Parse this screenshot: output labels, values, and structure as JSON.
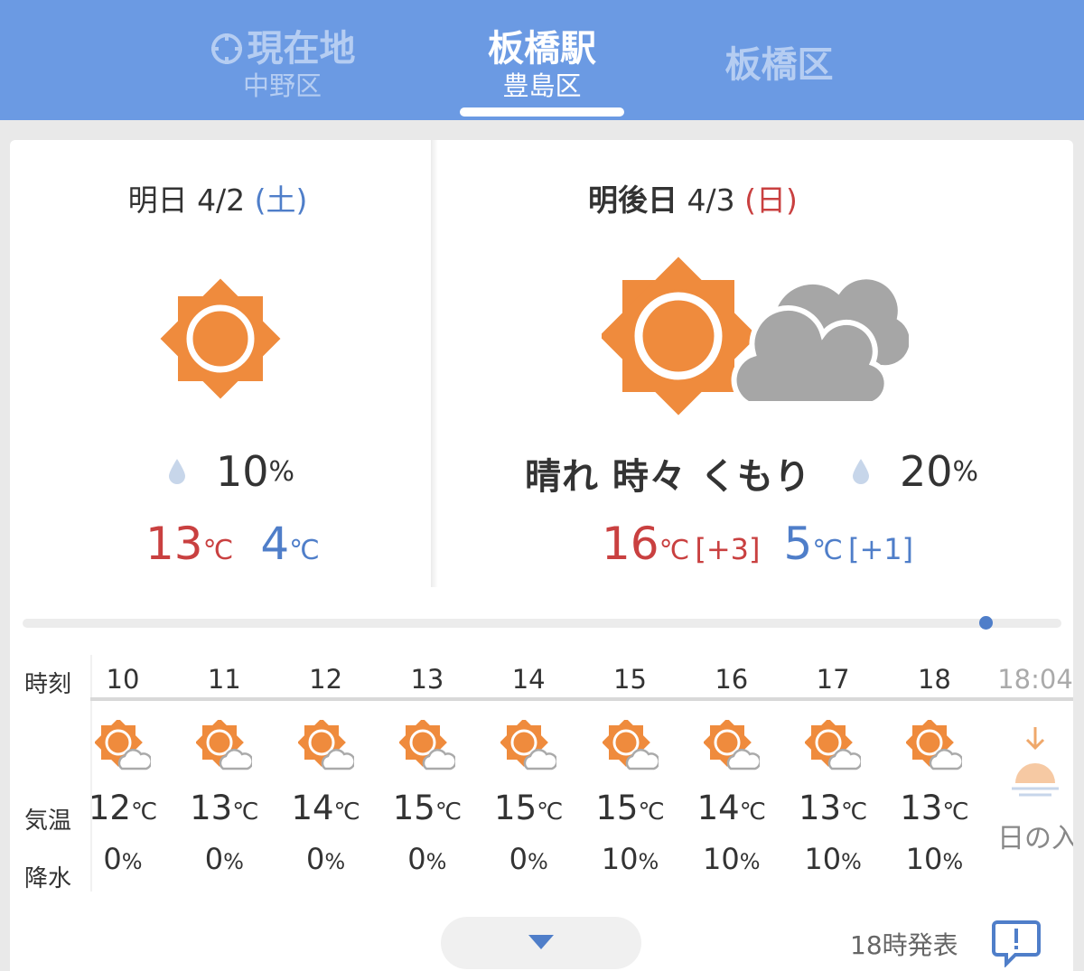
{
  "header": {
    "tabs": [
      {
        "title": "現在地",
        "subtitle": "中野区",
        "icon": "location-crosshair-icon"
      },
      {
        "title": "板橋駅",
        "subtitle": "豊島区",
        "active": true
      },
      {
        "title": "板橋区",
        "subtitle": ""
      }
    ]
  },
  "forecast": {
    "tomorrow": {
      "label": "明日",
      "date": "4/2",
      "dow": "(土)",
      "icon": "sunny-icon",
      "rain_value": "10",
      "rain_unit": "%",
      "high": "13",
      "low": "4",
      "temp_unit": "℃"
    },
    "day_after": {
      "label": "明後日",
      "date": "4/3",
      "dow": "(日)",
      "icon": "sunny-then-cloudy-icon",
      "weather": "晴れ 時々 くもり",
      "rain_value": "20",
      "rain_unit": "%",
      "high": "16",
      "high_diff": "[+3]",
      "low": "5",
      "low_diff": "[+1]",
      "temp_unit": "℃"
    }
  },
  "hourly": {
    "labels": {
      "time": "時刻",
      "temp": "気温",
      "rain": "降水"
    },
    "unit_temp": "℃",
    "unit_rain": "%",
    "hours": [
      {
        "hour": "10",
        "temp": "12",
        "rain": "0"
      },
      {
        "hour": "11",
        "temp": "13",
        "rain": "0"
      },
      {
        "hour": "12",
        "temp": "14",
        "rain": "0"
      },
      {
        "hour": "13",
        "temp": "15",
        "rain": "0"
      },
      {
        "hour": "14",
        "temp": "15",
        "rain": "0"
      },
      {
        "hour": "15",
        "temp": "15",
        "rain": "10"
      },
      {
        "hour": "16",
        "temp": "14",
        "rain": "10"
      },
      {
        "hour": "17",
        "temp": "13",
        "rain": "10"
      },
      {
        "hour": "18",
        "temp": "13",
        "rain": "10"
      }
    ],
    "sunset": {
      "time": "18:04",
      "label": "日の入"
    },
    "hour_icon": "sunny-with-cloud-icon"
  },
  "footer": {
    "announce": "18時発表",
    "expand_icon": "chevron-down-icon",
    "feedback_icon": "feedback-icon"
  },
  "colors": {
    "header_bg": "#6b9ae3",
    "sun": "#ef8b3d",
    "cloud": "#a6a6a6",
    "high": "#c94040",
    "low": "#4f7ec9",
    "saturday": "#4f7ec9",
    "sunday": "#c94040"
  }
}
